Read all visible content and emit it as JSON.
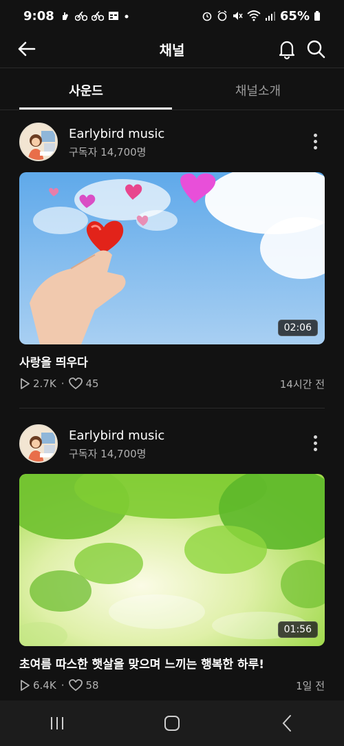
{
  "status_bar": {
    "time": "9:08",
    "battery": "65%",
    "left_icons": [
      "hand-icon",
      "bike-icon",
      "bike-icon",
      "calendar-icon",
      "dot-icon"
    ],
    "right_icons": [
      "alarm-icon",
      "mute-icon",
      "wifi-icon",
      "signal-icon",
      "battery-icon"
    ]
  },
  "app_bar": {
    "title": "채널"
  },
  "tabs": [
    {
      "label": "사운드",
      "active": true
    },
    {
      "label": "채널소개",
      "active": false
    }
  ],
  "posts": [
    {
      "channel_name": "Earlybird music",
      "subscribers": "구독자 14,700명",
      "duration": "02:06",
      "title": "사랑을 띄우다",
      "plays": "2.7K",
      "likes": "45",
      "time_ago": "14시간 전"
    },
    {
      "channel_name": "Earlybird music",
      "subscribers": "구독자 14,700명",
      "duration": "01:56",
      "title": "초여름 따스한 햇살을 맞으며 느끼는 행복한 하루!",
      "plays": "6.4K",
      "likes": "58",
      "time_ago": "1일 전"
    }
  ],
  "colors": {
    "background": "#121212",
    "text": "#ffffff",
    "muted": "#b0b0b0"
  }
}
